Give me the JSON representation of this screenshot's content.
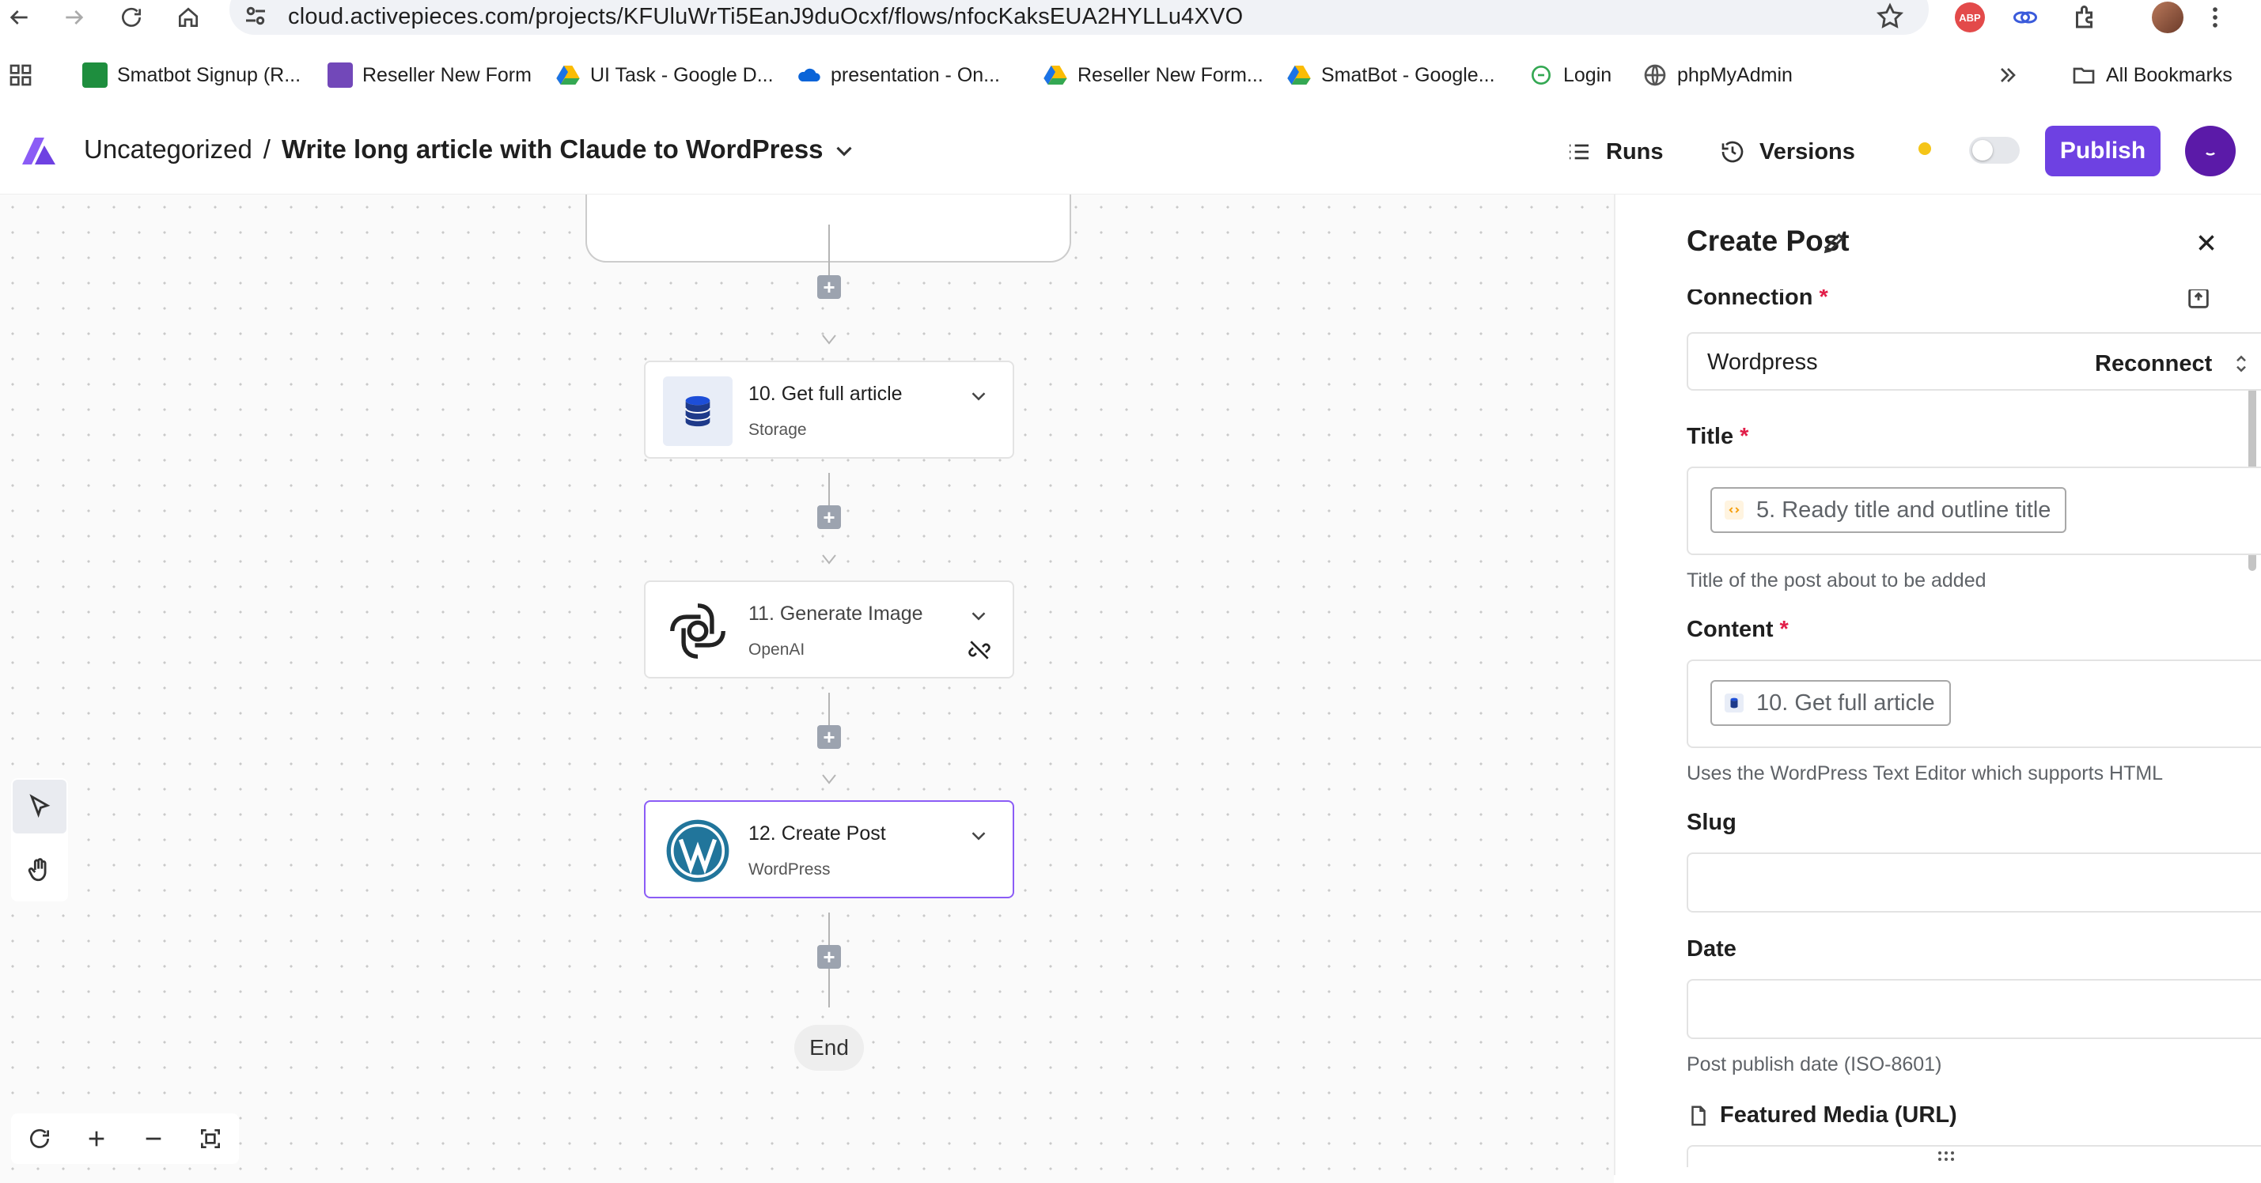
{
  "browser": {
    "url": "cloud.activepieces.com/projects/KFUluWrTi5EanJ9duOcxf/flows/nfocKaksEUA2HYLLu4XVO",
    "bookmarks": [
      {
        "label": "Smatbot Signup (R...",
        "icon": "sheets-icon"
      },
      {
        "label": "Reseller New Form",
        "icon": "forms-icon"
      },
      {
        "label": "UI Task - Google D...",
        "icon": "drive-icon"
      },
      {
        "label": "presentation - On...",
        "icon": "onedrive-icon"
      },
      {
        "label": "Reseller New Form...",
        "icon": "drive-icon"
      },
      {
        "label": "SmatBot - Google...",
        "icon": "drive-icon"
      },
      {
        "label": "Login",
        "icon": "login-icon"
      },
      {
        "label": "phpMyAdmin",
        "icon": "globe-icon"
      }
    ],
    "all_bookmarks": "All Bookmarks",
    "abp_label": "ABP"
  },
  "header": {
    "folder": "Uncategorized",
    "separator": "/",
    "flow_name": "Write long article with Claude to WordPress",
    "runs": "Runs",
    "versions": "Versions",
    "publish": "Publish"
  },
  "canvas": {
    "steps": [
      {
        "title": "10. Get full article",
        "subtitle": "Storage",
        "icon": "database-icon"
      },
      {
        "title": "11. Generate Image",
        "subtitle": "OpenAI",
        "icon": "openai-icon"
      },
      {
        "title": "12. Create Post",
        "subtitle": "WordPress",
        "icon": "wordpress-icon"
      }
    ],
    "end_label": "End",
    "plus": "+"
  },
  "panel": {
    "title": "Create Post",
    "connection_label": "Connection",
    "connection_value": "Wordpress",
    "reconnect": "Reconnect",
    "title_label": "Title",
    "title_chip": "5. Ready title and outline title",
    "title_help": "Title of the post about to be added",
    "content_label": "Content",
    "content_chip": "10. Get full article",
    "content_help": "Uses the WordPress Text Editor which supports HTML",
    "slug_label": "Slug",
    "date_label": "Date",
    "date_help": "Post publish date (ISO-8601)",
    "featured_label": "Featured Media (URL)",
    "required_mark": "*"
  },
  "colors": {
    "brand": "#6e41e2",
    "selected_border": "#8b5cf6",
    "required": "#e11d48",
    "status_dot": "#f5c518"
  }
}
